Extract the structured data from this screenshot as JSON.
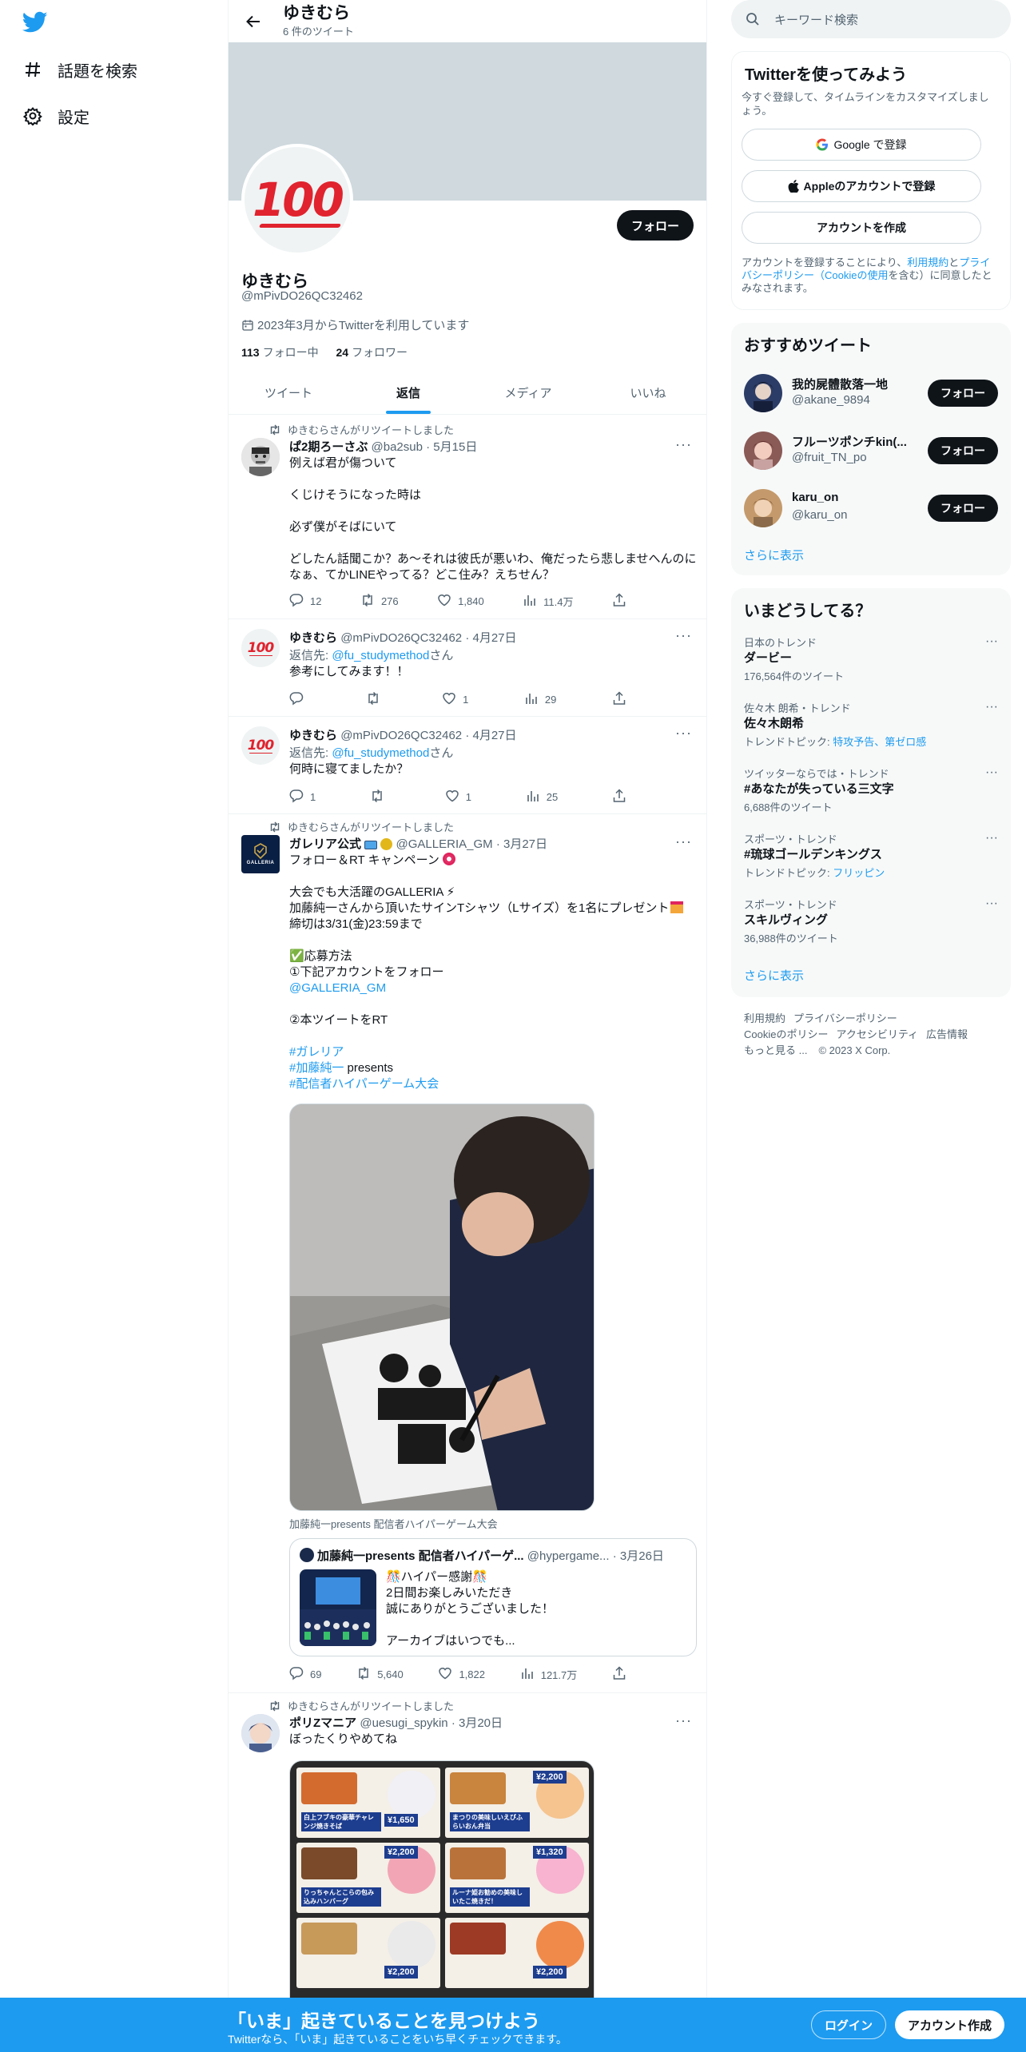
{
  "nav": {
    "items": [
      {
        "label": "話題を検索"
      },
      {
        "label": "設定"
      }
    ]
  },
  "header": {
    "title": "ゆきむら",
    "subtitle": "6 件のツイート"
  },
  "profile": {
    "name": "ゆきむら",
    "handle": "@mPivDO26QC32462",
    "joined": "2023年3月からTwitterを利用しています",
    "following_count": "113",
    "following_label": "フォロー中",
    "followers_count": "24",
    "followers_label": "フォロワー",
    "follow_label": "フォロー"
  },
  "tabs": [
    {
      "label": "ツイート"
    },
    {
      "label": "返信"
    },
    {
      "label": "メディア"
    },
    {
      "label": "いいね"
    }
  ],
  "tweets": [
    {
      "rt": "ゆきむらさんがリツイートしました",
      "name": "ぱ2期ろーさぶ",
      "handle": "@ba2sub",
      "date": "· 5月15日",
      "text": "例えば君が傷ついて\n\nくじけそうになった時は\n\n必ず僕がそばにいて\n\nどしたん話聞こか？あ〜それは彼氏が悪いわ、俺だったら悲しませへんのになぁ、てかLINEやってる？どこ住み？えちせん？",
      "replies": "12",
      "retweets": "276",
      "likes": "1,840",
      "views": "11.4万"
    },
    {
      "name": "ゆきむら",
      "handle": "@mPivDO26QC32462",
      "date": "· 4月27日",
      "reply_prefix": "返信先:",
      "reply_to": "@fu_studymethod",
      "reply_suffix": "さん",
      "text": "参考にしてみます！！",
      "replies": "",
      "retweets": "",
      "likes": "1",
      "views": "29"
    },
    {
      "name": "ゆきむら",
      "handle": "@mPivDO26QC32462",
      "date": "· 4月27日",
      "reply_prefix": "返信先:",
      "reply_to": "@fu_studymethod",
      "reply_suffix": "さん",
      "text": "何時に寝てましたか？",
      "replies": "1",
      "retweets": "",
      "likes": "1",
      "views": "25"
    },
    {
      "rt": "ゆきむらさんがリツイートしました",
      "name": "ガレリア公式",
      "handle": "@GALLERIA_GM",
      "date": "· 3月27日",
      "avatar_text": "GALLERIA",
      "l1": "フォロー＆RT キャンペーン",
      "l2": "大会でも大活躍のGALLERIA ⚡",
      "l3": "加藤純一さんから頂いたサインTシャツ（Lサイズ）を1名にプレゼント",
      "l4": "締切は3/31(金)23:59まで",
      "l5": "✅応募方法",
      "l6": "①下記アカウントをフォロー",
      "l7": "@GALLERIA_GM",
      "l8": "②本ツイートをRT",
      "l9": "#ガレリア",
      "l10a": "#加藤純一",
      "l10b": " presents",
      "l11": "#配信者ハイパーゲーム大会",
      "caption": "加藤純一presents 配信者ハイパーゲーム大会",
      "quote": {
        "name": "加藤純一presents 配信者ハイパーゲ...",
        "handle": "@hypergame...",
        "date": "· 3月26日",
        "text": "🎊ハイパー感謝🎊\n2日間お楽しみいただき\n誠にありがとうございました！\n\nアーカイブはいつでも..."
      },
      "replies": "69",
      "retweets": "5,640",
      "likes": "1,822",
      "views": "121.7万"
    },
    {
      "rt": "ゆきむらさんがリツイートしました",
      "name": "ポリZマニア",
      "handle": "@uesugi_spykin",
      "date": "· 3月20日",
      "text": "ぼったくりやめてね",
      "menu": [
        {
          "title": "白上フブキの豪華チャレンジ焼きそば",
          "price": "¥1,650"
        },
        {
          "title": "まつりの美味しいえびふらいおん弁当",
          "price": "¥2,200"
        },
        {
          "title": "りっちゃんとこらの包み込みハンバーグ",
          "price": "¥2,200"
        },
        {
          "title": "ルーナ姫お勧めの美味しいたこ焼きだ！",
          "price": "¥1,320"
        },
        {
          "title": "",
          "price": "¥2,200"
        },
        {
          "title": "",
          "price": "¥2,200"
        }
      ]
    }
  ],
  "signup": {
    "title": "Twitterを使ってみよう",
    "desc": "今すぐ登録して、タイムラインをカスタマイズしましょう。",
    "google": "Google で登録",
    "apple": "Appleのアカウントで登録",
    "create": "アカウントを作成",
    "terms1": "アカウントを登録することにより、",
    "terms_link1": "利用規約",
    "terms2": "と",
    "terms_link2": "プライバシーポリシー（Cookieの使用",
    "terms3": "を含む）に同意したとみなされます。"
  },
  "search": {
    "placeholder": "キーワード検索"
  },
  "recommended": {
    "title": "おすすめツイート",
    "users": [
      {
        "name": "我的屍體散落一地",
        "handle": "@akane_9894"
      },
      {
        "name": "フルーツポンチkin(...",
        "handle": "@fruit_TN_po"
      },
      {
        "name": "karu_on",
        "handle": "@karu_on"
      }
    ],
    "follow": "フォロー",
    "more": "さらに表示"
  },
  "trends": {
    "title": "いまどうしてる？",
    "items": [
      {
        "ctx": "日本のトレンド",
        "name": "ダービー",
        "meta": "176,564件のツイート"
      },
      {
        "ctx": "佐々木 朗希・トレンド",
        "name": "佐々木朗希",
        "meta_prefix": "トレンドトピック:",
        "meta_link": "特攻予告、第ゼロ感"
      },
      {
        "ctx": "ツイッターならでは・トレンド",
        "name": "#あなたが失っている三文字",
        "meta": "6,688件のツイート"
      },
      {
        "ctx": "スポーツ・トレンド",
        "name": "#琉球ゴールデンキングス",
        "meta_prefix": "トレンドトピック:",
        "meta_link": "フリッピン"
      },
      {
        "ctx": "スポーツ・トレンド",
        "name": "スキルヴィング",
        "meta": "36,988件のツイート"
      }
    ],
    "more": "さらに表示"
  },
  "footer_links": {
    "l1": "利用規約",
    "l2": "プライバシーポリシー",
    "l3": "Cookieのポリシー",
    "l4": "アクセシビリティ",
    "l5": "広告情報",
    "l6": "もっと見る ...",
    "l7": "© 2023 X Corp."
  },
  "bottom": {
    "title": "「いま」起きていることを見つけよう",
    "sub": "Twitterなら、「いま」起きていることをいち早くチェックできます。",
    "login": "ログイン",
    "signup": "アカウント作成"
  },
  "colors": {
    "accent": "#1d9bf0",
    "text": "#0f1419",
    "muted": "#536471"
  }
}
